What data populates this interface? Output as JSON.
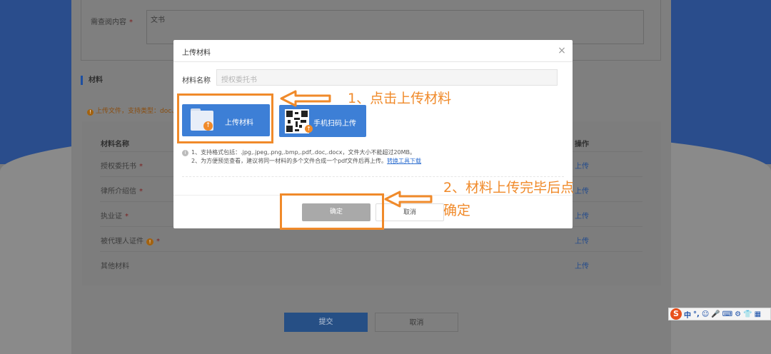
{
  "background": {
    "query_label": "需查阅内容",
    "query_value": "文书",
    "section_title": "材料",
    "tip": "上传文件，支持类型：doc、",
    "table": {
      "headers": {
        "name": "材料名称",
        "action": "操作"
      },
      "rows": [
        {
          "label": "授权委托书",
          "mark": "*",
          "action": "上传"
        },
        {
          "label": "律所介绍信",
          "mark": "*",
          "action": "上传"
        },
        {
          "label": "执业证",
          "mark": "*",
          "action": "上传"
        },
        {
          "label": "被代理人证件",
          "mark": "*",
          "action": "上传"
        },
        {
          "label": "其他材料",
          "mark": "",
          "action": "上传"
        }
      ]
    },
    "submit_label": "提交",
    "cancel_label": "取消"
  },
  "dialog": {
    "title": "上传材料",
    "close_glyph": "×",
    "name_label": "材料名称",
    "name_placeholder": "授权委托书",
    "upload_button_label": "上传材料",
    "scan_button_label": "手机扫码上传",
    "note_1": "1、支持格式包括：.jpg,.jpeg,.png,.bmp,.pdf,.doc,.docx，文件大小不能超过20MB。",
    "note_2": "2、为方便预览查看，建议将同一材料的多个文件合成一个pdf文件后再上传。",
    "note_link": "转换工具下载",
    "ok_label": "确定",
    "cancel_label": "取消"
  },
  "annotations": {
    "step1": "1、点击上传材料",
    "step2_line1": "2、材料上传完毕后点",
    "step2_line2": "确定"
  },
  "ime": {
    "logo": "S",
    "items": [
      "中",
      "°,",
      "☺",
      "🎤",
      "⌨",
      "⚙",
      "👕",
      "▦"
    ]
  },
  "colors": {
    "annotation": "#f08a2a",
    "primary_button": "#3d7fd6",
    "ok_button_disabled": "#a9a9a9"
  }
}
